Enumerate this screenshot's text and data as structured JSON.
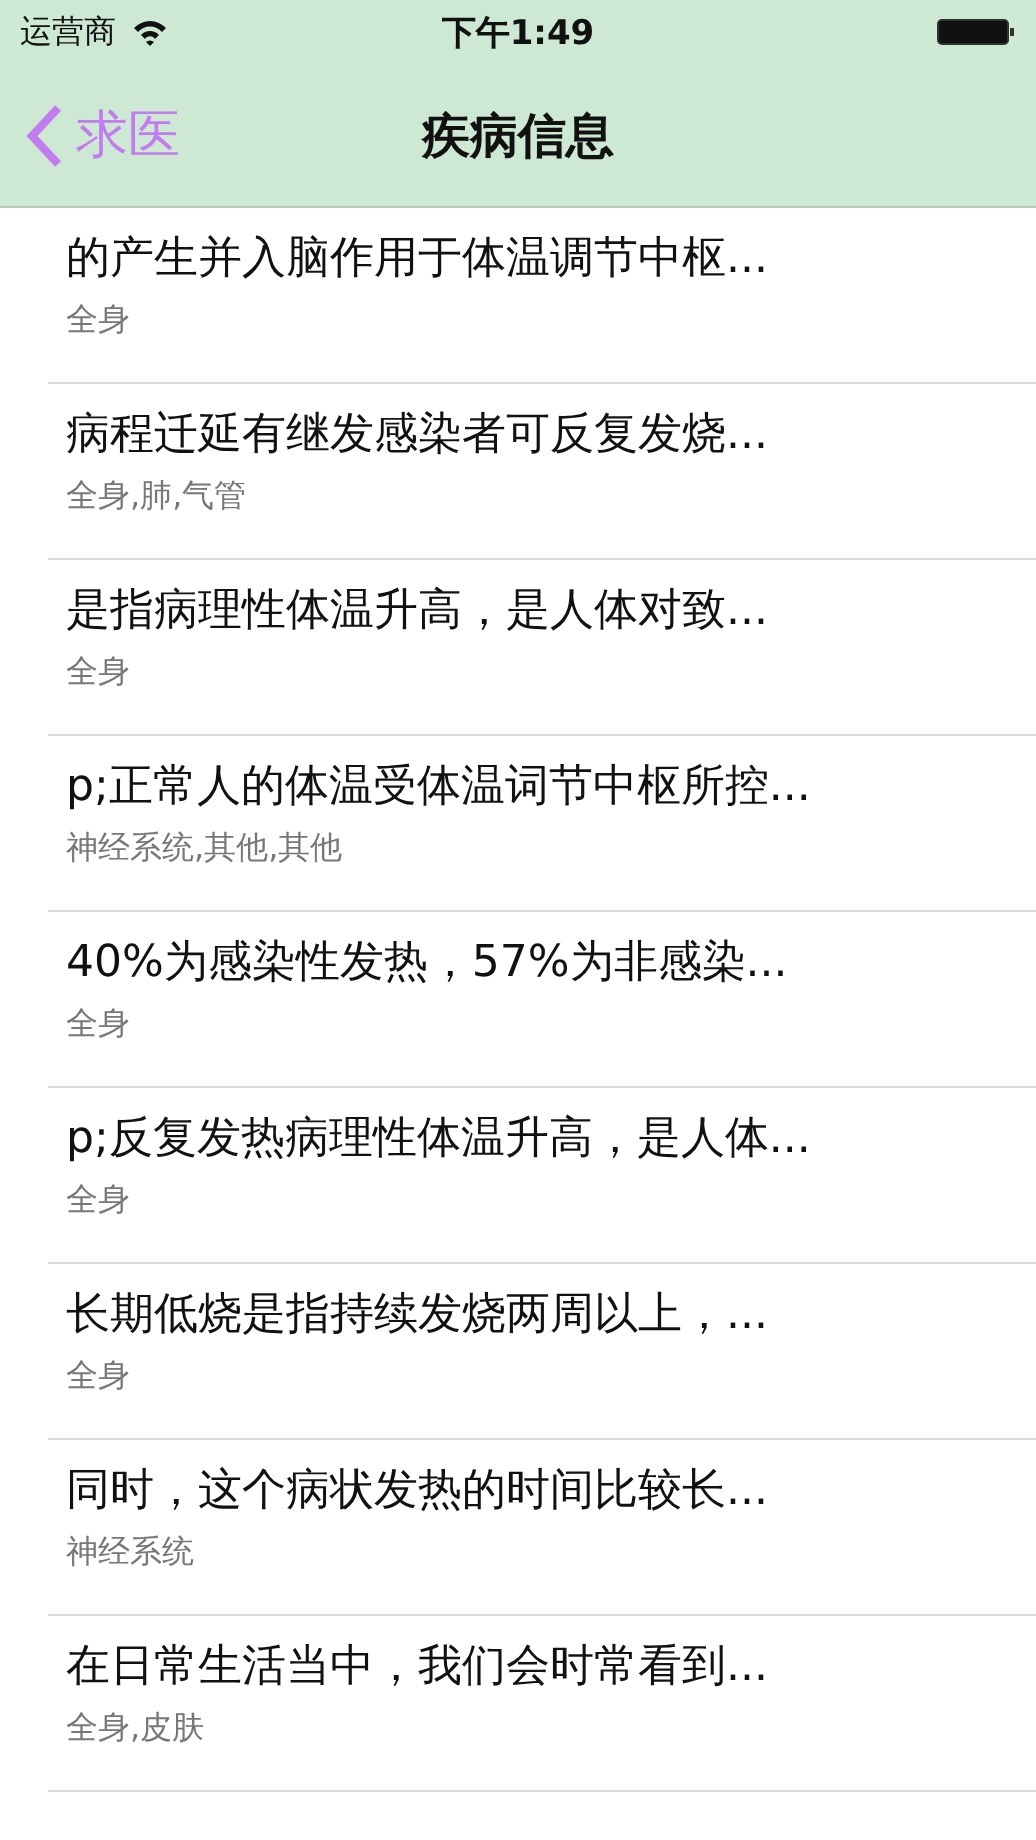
{
  "status_bar": {
    "carrier": "运营商",
    "time": "下午1:49"
  },
  "nav_bar": {
    "back_label": "求医",
    "title": "疾病信息"
  },
  "rows": [
    {
      "title": "的产生并入脑作用于体温调节中枢...",
      "subtitle": "全身"
    },
    {
      "title": "病程迁延有继发感染者可反复发烧...",
      "subtitle": "全身,肺,气管"
    },
    {
      "title": "是指病理性体温升高，是人体对致...",
      "subtitle": "全身"
    },
    {
      "title": "p;正常人的体温受体温词节中枢所控...",
      "subtitle": "神经系统,其他,其他"
    },
    {
      "title": "40%为感染性发热，57%为非感染...",
      "subtitle": "全身"
    },
    {
      "title": "p;反复发热病理性体温升高，是人体...",
      "subtitle": "全身"
    },
    {
      "title": "长期低烧是指持续发烧两周以上，...",
      "subtitle": "全身"
    },
    {
      "title": "同时，这个病状发热的时间比较长...",
      "subtitle": "神经系统"
    },
    {
      "title": "在日常生活当中，我们会时常看到...",
      "subtitle": "全身,皮肤"
    }
  ]
}
